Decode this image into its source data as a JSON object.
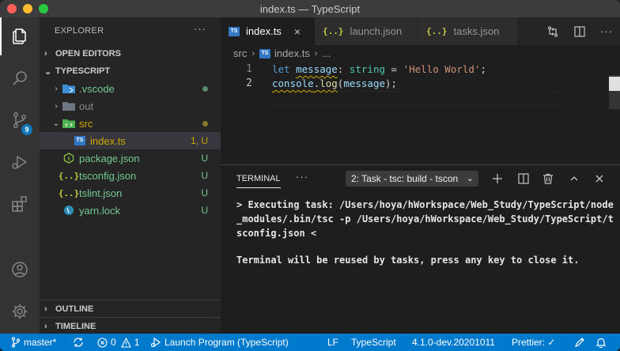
{
  "window": {
    "title": "index.ts — TypeScript"
  },
  "activity_bar": {
    "scm_badge": "9"
  },
  "sidebar": {
    "header": "EXPLORER",
    "more": "···",
    "open_editors": "OPEN EDITORS",
    "project": "TYPESCRIPT",
    "files": [
      {
        "name": ".vscode",
        "status": "",
        "color": "#73c991"
      },
      {
        "name": "out",
        "status": "",
        "color": "#8c8c8c"
      },
      {
        "name": "src",
        "status": "",
        "color": "#cca700"
      },
      {
        "name": "index.ts",
        "status": "1, U",
        "color": "#cca700"
      },
      {
        "name": "package.json",
        "status": "U",
        "color": "#73c991"
      },
      {
        "name": "tsconfig.json",
        "status": "U",
        "color": "#73c991"
      },
      {
        "name": "tslint.json",
        "status": "U",
        "color": "#73c991"
      },
      {
        "name": "yarn.lock",
        "status": "U",
        "color": "#73c991"
      }
    ],
    "outline": "OUTLINE",
    "timeline": "TIMELINE"
  },
  "tabs": [
    {
      "label": "index.ts",
      "close": "×"
    },
    {
      "label": "launch.json"
    },
    {
      "label": "tasks.json"
    }
  ],
  "breadcrumb": {
    "folder": "src",
    "file": "index.ts",
    "more": "..."
  },
  "code": {
    "line_numbers": [
      "1",
      "2"
    ],
    "line1": {
      "kw": "let",
      "var": "message",
      "colon": ":",
      "type": "string",
      "eq": "=",
      "str": "'Hello World'",
      "semi": ";"
    },
    "line2": {
      "obj": "console",
      "dot": ".",
      "fn": "log",
      "open": "(",
      "arg": "message",
      "close": ");"
    }
  },
  "panel": {
    "tab": "TERMINAL",
    "more": "···",
    "select": "2: Task - tsc: build - tscon",
    "lines": [
      "> Executing task: /Users/hoya/hWorkspace/Web_Study/TypeScript/node",
      "_modules/.bin/tsc -p /Users/hoya/hWorkspace/Web_Study/TypeScript/t",
      "sconfig.json <",
      "Terminal will be reused by tasks, press any key to close it."
    ]
  },
  "statusbar": {
    "branch": "master*",
    "errors": "0",
    "warnings": "1",
    "launch": "Launch Program (TypeScript)",
    "eol": "LF",
    "language": "TypeScript",
    "version": "4.1.0-dev.20201011",
    "prettier": "Prettier: ✓"
  },
  "colors": {
    "accent": "#007acc",
    "untracked": "#73c991",
    "modified": "#cca700"
  }
}
